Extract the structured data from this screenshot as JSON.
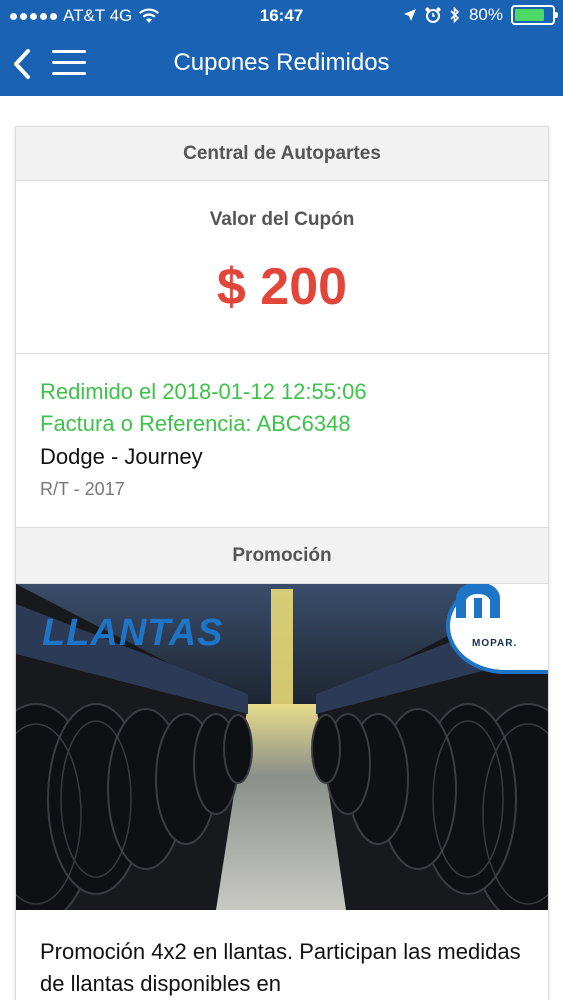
{
  "status_bar": {
    "carrier": "AT&T 4G",
    "time": "16:47",
    "battery": "80%"
  },
  "navbar": {
    "title": "Cupones Redimidos"
  },
  "card": {
    "store_name": "Central de Autopartes",
    "value_label": "Valor del Cupón",
    "value_amount": "$ 200",
    "redeemed": "Redimido el 2018-01-12 12:55:06",
    "reference": "Factura o Referencia: ABC6348",
    "vehicle": "Dodge - Journey",
    "vehicle_detail": "R/T - 2017",
    "promo_label": "Promoción",
    "promo_image_text": "LLANTAS",
    "promo_brand": "MOPAR.",
    "promo_description": "Promoción 4x2 en llantas. Participan las medidas de llantas disponibles en"
  },
  "colors": {
    "header": "#1a62b4",
    "value_amount": "#e2463b",
    "redeemed_text": "#3dc24a"
  }
}
